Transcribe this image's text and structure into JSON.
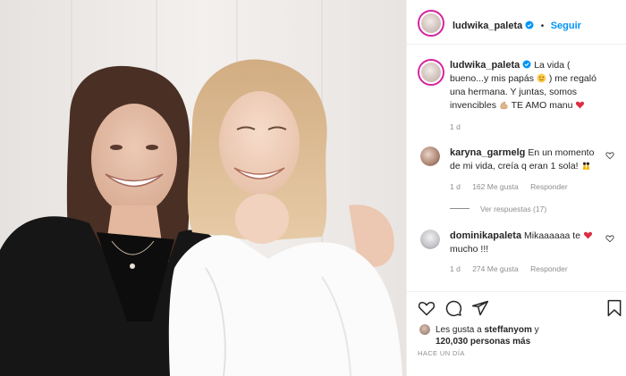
{
  "header": {
    "username": "ludwika_paleta",
    "separator": "•",
    "follow_label": "Seguir"
  },
  "caption": {
    "username": "ludwika_paleta",
    "text_part1": "La vida ( bueno...y mis papás",
    "text_part2": ") me regaló una hermana. Y juntas, somos invencibles",
    "text_part3": "TE AMO manu",
    "time": "1 d"
  },
  "comments": [
    {
      "username": "karyna_garmelg",
      "text": "En un momento de mi vida, creía q eran 1 sola!",
      "time": "1 d",
      "likes": "162 Me gusta",
      "reply": "Responder",
      "view_replies": "Ver respuestas (17)"
    },
    {
      "username": "dominikapaleta",
      "text_part1": "Mikaaaaaa te",
      "text_part2": "mucho !!!",
      "time": "1 d",
      "likes": "274 Me gusta",
      "reply": "Responder"
    }
  ],
  "likes": {
    "prefix": "Les gusta a",
    "user": "steffanyom",
    "suffix": "y",
    "count": "120,030 personas más"
  },
  "timestamp": "HACE UN DÍA",
  "colors": {
    "accent": "#0095f6",
    "heart": "#ed4956",
    "text": "#262626",
    "muted": "#8e8e8e"
  },
  "icons": [
    "heart-icon",
    "comment-icon",
    "share-icon",
    "bookmark-icon",
    "verified-icon"
  ]
}
